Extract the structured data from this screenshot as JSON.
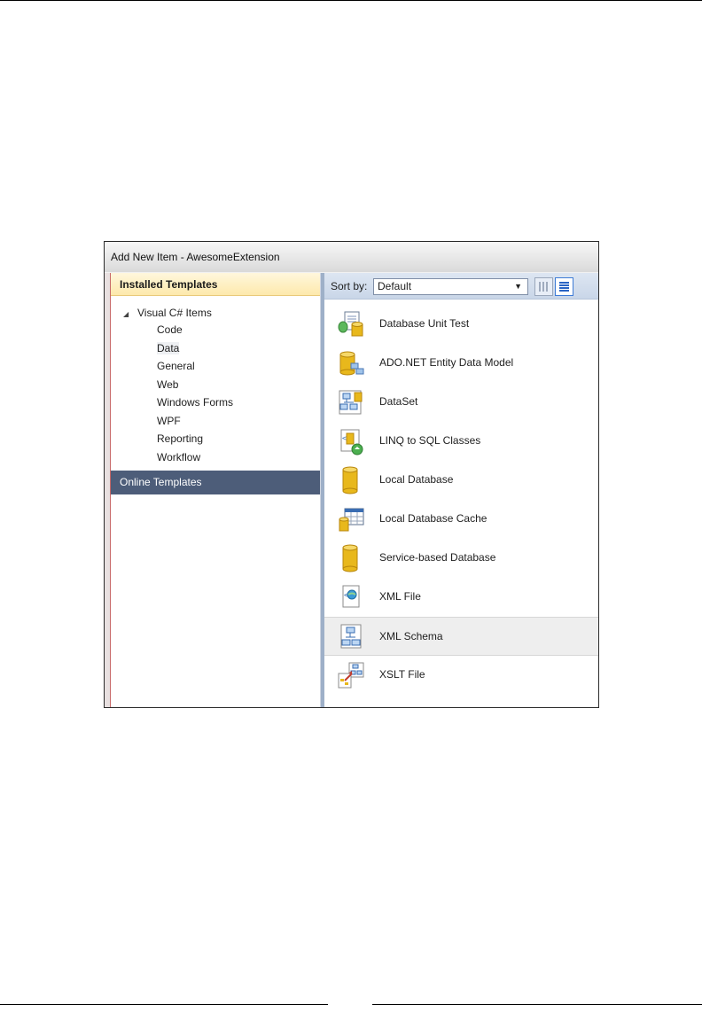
{
  "window": {
    "title": "Add New Item - AwesomeExtension"
  },
  "left_panel": {
    "installed_header": "Installed Templates",
    "tree_root": "Visual C# Items",
    "categories": [
      {
        "label": "Code"
      },
      {
        "label": "Data"
      },
      {
        "label": "General"
      },
      {
        "label": "Web"
      },
      {
        "label": "Windows Forms"
      },
      {
        "label": "WPF"
      },
      {
        "label": "Reporting"
      },
      {
        "label": "Workflow"
      }
    ],
    "selected_category": "Data",
    "online_header": "Online Templates"
  },
  "sort_bar": {
    "label": "Sort by:",
    "selected_value": "Default"
  },
  "templates": [
    {
      "label": "Database Unit Test",
      "icon": "database-unit-test-icon"
    },
    {
      "label": "ADO.NET Entity Data Model",
      "icon": "entity-data-model-icon"
    },
    {
      "label": "DataSet",
      "icon": "dataset-icon"
    },
    {
      "label": "LINQ to SQL Classes",
      "icon": "linq-to-sql-icon"
    },
    {
      "label": "Local Database",
      "icon": "local-database-icon"
    },
    {
      "label": "Local Database Cache",
      "icon": "local-database-cache-icon"
    },
    {
      "label": "Service-based Database",
      "icon": "service-based-database-icon"
    },
    {
      "label": "XML File",
      "icon": "xml-file-icon"
    },
    {
      "label": "XML Schema",
      "icon": "xml-schema-icon"
    },
    {
      "label": "XSLT File",
      "icon": "xslt-file-icon"
    }
  ],
  "selected_template": "XML Schema",
  "colors": {
    "online_header_bg": "#4d5d79",
    "installed_header_bg": "#fde9ac",
    "database_gold": "#e8b81c",
    "splitter": "#9eb0c8"
  }
}
